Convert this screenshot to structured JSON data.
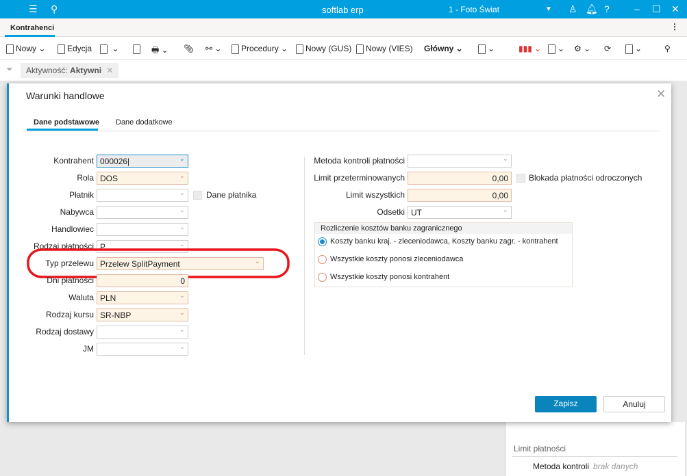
{
  "app": {
    "title": "softlab erp",
    "company": "1 - Foto Świat"
  },
  "tabs": [
    {
      "label": "Kontrahenci",
      "active": true
    }
  ],
  "toolbar": {
    "new": "Nowy",
    "edit": "Edycja",
    "procedures": "Procedury",
    "new_gus": "Nowy (GUS)",
    "new_vies": "Nowy (VIES)",
    "view": "Główny"
  },
  "filter": {
    "label": "Aktywność:",
    "value": "Aktywni"
  },
  "dialog": {
    "title": "Warunki handlowe",
    "tabs": [
      {
        "label": "Dane podstawowe",
        "active": true
      },
      {
        "label": "Dane dodatkowe",
        "active": false
      }
    ],
    "left_fields": [
      {
        "label": "Kontrahent",
        "value": "000026"
      },
      {
        "label": "Rola",
        "value": "DOS"
      },
      {
        "label": "Płatnik",
        "value": ""
      },
      {
        "label": "Nabywca",
        "value": ""
      },
      {
        "label": "Handlowiec",
        "value": ""
      },
      {
        "label": "Rodzaj płatności",
        "value": "P"
      },
      {
        "label": "Typ przelewu",
        "value": "Przelew SplitPayment"
      },
      {
        "label": "Dni płatności",
        "value": "0"
      },
      {
        "label": "Waluta",
        "value": "PLN"
      },
      {
        "label": "Rodzaj kursu",
        "value": "SR-NBP"
      },
      {
        "label": "Rodzaj dostawy",
        "value": ""
      },
      {
        "label": "JM",
        "value": ""
      }
    ],
    "payer_data_checkbox": {
      "label": "Dane płatnika",
      "checked": false
    },
    "right_fields": [
      {
        "label": "Metoda kontroli płatności",
        "value": ""
      },
      {
        "label": "Limit przeterminowanych",
        "value": "0,00"
      },
      {
        "label": "Limit wszystkich",
        "value": "0,00"
      },
      {
        "label": "Odsetki",
        "value": "UT"
      }
    ],
    "block_checkbox": {
      "label": "Blokada płatności odroczonych",
      "checked": false
    },
    "bank_costs": {
      "title": "Rozliczenie kosztów banku zagranicznego",
      "options": [
        {
          "label": "Koszty banku kraj. - zleceniodawca, Koszty banku zagr. - kontrahent",
          "selected": true
        },
        {
          "label": "Wszystkie koszty ponosi zleceniodawca",
          "selected": false
        },
        {
          "label": "Wszystkie koszty ponosi kontrahent",
          "selected": false
        }
      ]
    },
    "save": "Zapisz",
    "cancel": "Anuluj"
  },
  "background_panel": {
    "section": "Limit płatności",
    "row_label": "Metoda kontroli",
    "row_value": "brak danych"
  },
  "colors": {
    "accent": "#009fe0",
    "primary_button": "#0a84bd",
    "highlight": "#e8141b"
  }
}
